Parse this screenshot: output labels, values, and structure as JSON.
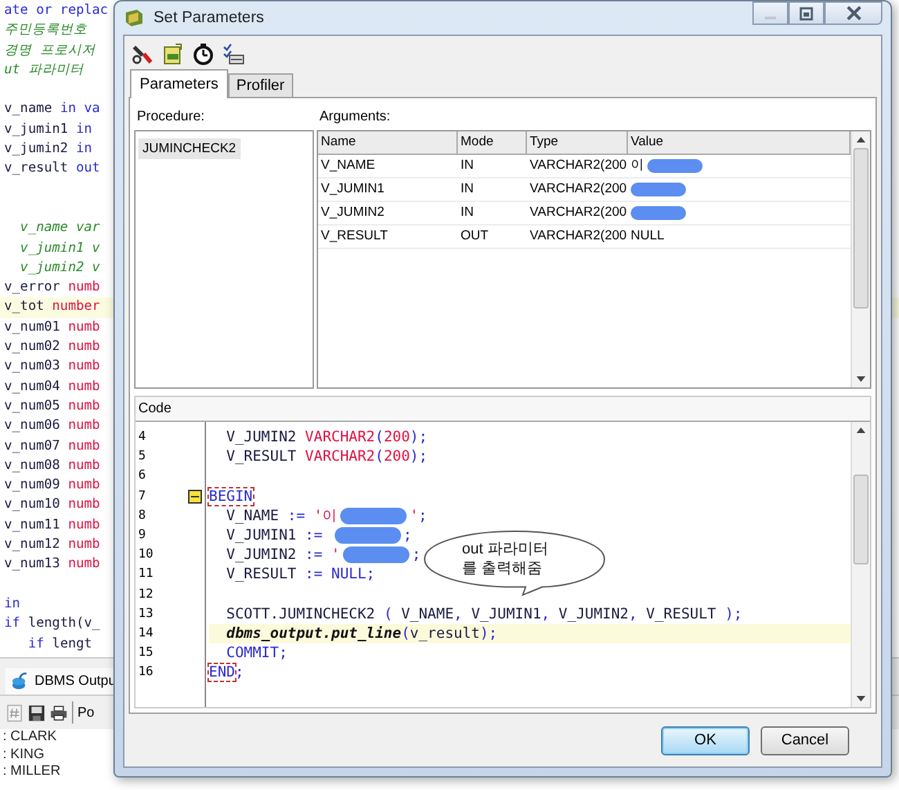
{
  "background_editor": {
    "lines": [
      {
        "current": false,
        "tokens": [
          {
            "text": "ate or replac",
            "kind": "kw"
          }
        ]
      },
      {
        "current": false,
        "tokens": [
          {
            "text": "주민등록번호",
            "kind": "comment"
          }
        ]
      },
      {
        "current": false,
        "tokens": [
          {
            "text": "경명 프로시저",
            "kind": "comment"
          }
        ]
      },
      {
        "current": false,
        "tokens": [
          {
            "text": "ut 파라미터",
            "kind": "comment"
          }
        ]
      },
      {
        "current": false
      },
      {
        "current": false,
        "tokens": [
          {
            "text": "v_name ",
            "kind": "plain"
          },
          {
            "text": "in va",
            "kind": "kw"
          }
        ]
      },
      {
        "current": false,
        "tokens": [
          {
            "text": "v_jumin1 ",
            "kind": "plain"
          },
          {
            "text": "in",
            "kind": "kw"
          }
        ]
      },
      {
        "current": false,
        "tokens": [
          {
            "text": "v_jumin2 ",
            "kind": "plain"
          },
          {
            "text": "in",
            "kind": "kw"
          }
        ]
      },
      {
        "current": false,
        "tokens": [
          {
            "text": "v_result ",
            "kind": "plain"
          },
          {
            "text": "out",
            "kind": "kw"
          }
        ]
      },
      {
        "current": false
      },
      {
        "current": false
      },
      {
        "current": false,
        "tokens": [
          {
            "text": "  v_name var",
            "kind": "comment"
          }
        ]
      },
      {
        "current": false,
        "tokens": [
          {
            "text": "  v_jumin1 v",
            "kind": "comment"
          }
        ]
      },
      {
        "current": false,
        "tokens": [
          {
            "text": "  v_jumin2 v",
            "kind": "comment"
          }
        ]
      },
      {
        "current": false,
        "tokens": [
          {
            "text": "v_error ",
            "kind": "plain"
          },
          {
            "text": "numb",
            "kind": "type"
          }
        ]
      },
      {
        "current": true,
        "tokens": [
          {
            "text": "v_tot ",
            "kind": "plain"
          },
          {
            "text": "number",
            "kind": "type"
          }
        ]
      },
      {
        "current": false,
        "tokens": [
          {
            "text": "v_num01 ",
            "kind": "plain"
          },
          {
            "text": "numb",
            "kind": "type"
          }
        ]
      },
      {
        "current": false,
        "tokens": [
          {
            "text": "v_num02 ",
            "kind": "plain"
          },
          {
            "text": "numb",
            "kind": "type"
          }
        ]
      },
      {
        "current": false,
        "tokens": [
          {
            "text": "v_num03 ",
            "kind": "plain"
          },
          {
            "text": "numb",
            "kind": "type"
          }
        ]
      },
      {
        "current": false,
        "tokens": [
          {
            "text": "v_num04 ",
            "kind": "plain"
          },
          {
            "text": "numb",
            "kind": "type"
          }
        ]
      },
      {
        "current": false,
        "tokens": [
          {
            "text": "v_num05 ",
            "kind": "plain"
          },
          {
            "text": "numb",
            "kind": "type"
          }
        ]
      },
      {
        "current": false,
        "tokens": [
          {
            "text": "v_num06 ",
            "kind": "plain"
          },
          {
            "text": "numb",
            "kind": "type"
          }
        ]
      },
      {
        "current": false,
        "tokens": [
          {
            "text": "v_num07 ",
            "kind": "plain"
          },
          {
            "text": "numb",
            "kind": "type"
          }
        ]
      },
      {
        "current": false,
        "tokens": [
          {
            "text": "v_num08 ",
            "kind": "plain"
          },
          {
            "text": "numb",
            "kind": "type"
          }
        ]
      },
      {
        "current": false,
        "tokens": [
          {
            "text": "v_num09 ",
            "kind": "plain"
          },
          {
            "text": "numb",
            "kind": "type"
          }
        ]
      },
      {
        "current": false,
        "tokens": [
          {
            "text": "v_num10 ",
            "kind": "plain"
          },
          {
            "text": "numb",
            "kind": "type"
          }
        ]
      },
      {
        "current": false,
        "tokens": [
          {
            "text": "v_num11 ",
            "kind": "plain"
          },
          {
            "text": "numb",
            "kind": "type"
          }
        ]
      },
      {
        "current": false,
        "tokens": [
          {
            "text": "v_num12 ",
            "kind": "plain"
          },
          {
            "text": "numb",
            "kind": "type"
          }
        ]
      },
      {
        "current": false,
        "tokens": [
          {
            "text": "v_num13 ",
            "kind": "plain"
          },
          {
            "text": "numb",
            "kind": "type"
          }
        ]
      },
      {
        "current": false
      },
      {
        "current": false,
        "tokens": [
          {
            "text": "in",
            "kind": "kw"
          }
        ]
      },
      {
        "current": false,
        "tokens": [
          {
            "text": "if",
            "kind": "kw"
          },
          {
            "text": " length(v_",
            "kind": "plain"
          }
        ]
      },
      {
        "current": false,
        "tokens": [
          {
            "text": "   if",
            "kind": "kw"
          },
          {
            "text": " lengt",
            "kind": "plain"
          }
        ]
      }
    ]
  },
  "output_panel": {
    "tab": "DBMS Outpu",
    "toolbar_text": "Po",
    "lines": [
      ": CLARK",
      ": KING",
      ": MILLER"
    ]
  },
  "dialog": {
    "title": "Set Parameters",
    "tabs": [
      {
        "label": "Parameters",
        "selected": true
      },
      {
        "label": "Profiler",
        "selected": false
      }
    ],
    "procedure": {
      "label": "Procedure:",
      "items": [
        {
          "label": "JUMINCHECK2",
          "selected": true
        }
      ]
    },
    "arguments": {
      "label": "Arguments:",
      "columns": [
        "Name",
        "Mode",
        "Type",
        "Value"
      ],
      "rows": [
        {
          "name": "V_NAME",
          "mode": "IN",
          "type": "VARCHAR2(200",
          "value": "이",
          "redacted": true
        },
        {
          "name": "V_JUMIN1",
          "mode": "IN",
          "type": "VARCHAR2(200",
          "redacted": true
        },
        {
          "name": "V_JUMIN2",
          "mode": "IN",
          "type": "VARCHAR2(200",
          "redacted": true
        },
        {
          "name": "V_RESULT",
          "mode": "OUT",
          "type": "VARCHAR2(200",
          "value": "NULL",
          "redacted": false
        }
      ]
    },
    "code": {
      "label": "Code",
      "lines": [
        {
          "no": "4",
          "current": false,
          "fold": false,
          "tokens": [
            {
              "text": "  V_JUMIN2 ",
              "kind": "plain"
            },
            {
              "text": "VARCHAR2",
              "kind": "type"
            },
            {
              "text": "(",
              "kind": "kw"
            },
            {
              "text": "200",
              "kind": "type"
            },
            {
              "text": ");",
              "kind": "kw"
            }
          ]
        },
        {
          "no": "5",
          "current": false,
          "fold": false,
          "tokens": [
            {
              "text": "  V_RESULT ",
              "kind": "plain"
            },
            {
              "text": "VARCHAR2",
              "kind": "type"
            },
            {
              "text": "(",
              "kind": "kw"
            },
            {
              "text": "200",
              "kind": "type"
            },
            {
              "text": ");",
              "kind": "kw"
            }
          ]
        },
        {
          "no": "6",
          "current": false,
          "fold": false
        },
        {
          "no": "7",
          "current": false,
          "fold": true,
          "tokens": [
            {
              "text": "BEGIN",
              "kind": "block"
            }
          ]
        },
        {
          "no": "8",
          "current": false,
          "fold": false,
          "tokens": [
            {
              "text": "  V_NAME ",
              "kind": "plain"
            },
            {
              "text": ":= ",
              "kind": "kw"
            },
            {
              "text": "'이",
              "kind": "str"
            },
            {
              "kind": "redacted"
            },
            {
              "text": "'",
              "kind": "str"
            },
            {
              "text": ";",
              "kind": "kw"
            }
          ]
        },
        {
          "no": "9",
          "current": false,
          "fold": false,
          "tokens": [
            {
              "text": "  V_JUMIN1 ",
              "kind": "plain"
            },
            {
              "text": ":= ",
              "kind": "kw"
            },
            {
              "kind": "redacted"
            },
            {
              "text": ";",
              "kind": "kw"
            }
          ]
        },
        {
          "no": "10",
          "current": false,
          "fold": false,
          "tokens": [
            {
              "text": "  V_JUMIN2 ",
              "kind": "plain"
            },
            {
              "text": ":= ",
              "kind": "kw"
            },
            {
              "text": "'",
              "kind": "str"
            },
            {
              "kind": "redacted"
            },
            {
              "text": ";",
              "kind": "kw"
            }
          ]
        },
        {
          "no": "11",
          "current": false,
          "fold": false,
          "tokens": [
            {
              "text": "  V_RESULT ",
              "kind": "plain"
            },
            {
              "text": ":= NULL;",
              "kind": "kw"
            }
          ]
        },
        {
          "no": "12",
          "current": false,
          "fold": false
        },
        {
          "no": "13",
          "current": false,
          "fold": false,
          "tokens": [
            {
              "text": "  SCOTT.JUMINCHECK2 ",
              "kind": "plain"
            },
            {
              "text": "( ",
              "kind": "kw"
            },
            {
              "text": "V_NAME",
              "kind": "plain"
            },
            {
              "text": ", ",
              "kind": "kw"
            },
            {
              "text": "V_JUMIN1",
              "kind": "plain"
            },
            {
              "text": ", ",
              "kind": "kw"
            },
            {
              "text": "V_JUMIN2",
              "kind": "plain"
            },
            {
              "text": ", ",
              "kind": "kw"
            },
            {
              "text": "V_RESULT ",
              "kind": "plain"
            },
            {
              "text": ");",
              "kind": "kw"
            }
          ]
        },
        {
          "no": "14",
          "current": true,
          "fold": false,
          "tokens": [
            {
              "text": "  dbms_output.put_line",
              "kind": "call"
            },
            {
              "text": "(",
              "kind": "kw"
            },
            {
              "text": "v_result",
              "kind": "plain"
            },
            {
              "text": ");",
              "kind": "kw"
            }
          ]
        },
        {
          "no": "15",
          "current": false,
          "fold": false,
          "tokens": [
            {
              "text": "  COMMIT;",
              "kind": "kw"
            }
          ]
        },
        {
          "no": "16",
          "current": false,
          "fold": false,
          "tokens": [
            {
              "text": "END",
              "kind": "block"
            },
            {
              "text": ";",
              "kind": "kw"
            }
          ]
        }
      ],
      "callout": "out 파라미터\n를 출력해줌"
    },
    "buttons": [
      {
        "label": "OK",
        "default": true
      },
      {
        "label": "Cancel",
        "default": false
      }
    ]
  }
}
